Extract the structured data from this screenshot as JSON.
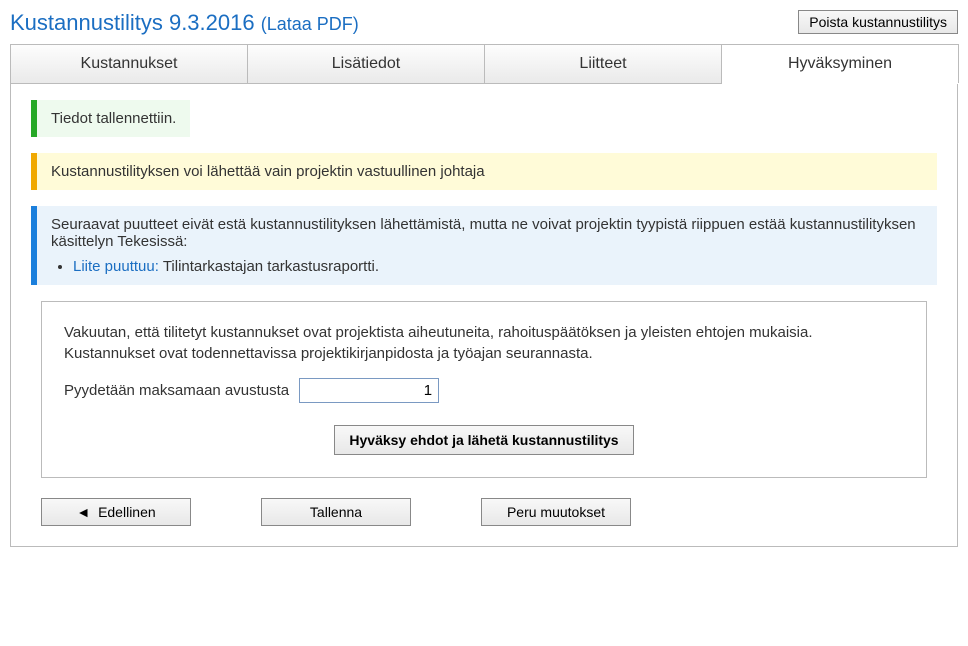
{
  "header": {
    "title": "Kustannustilitys 9.3.2016",
    "download_link": "(Lataa PDF)",
    "delete_button": "Poista kustannustilitys"
  },
  "tabs": {
    "costs": "Kustannukset",
    "details": "Lisätiedot",
    "attachments": "Liitteet",
    "approval": "Hyväksyminen"
  },
  "alerts": {
    "saved": "Tiedot tallennettiin.",
    "only_leader": "Kustannustilityksen voi lähettää vain projektin vastuullinen johtaja",
    "missing_intro": "Seuraavat puutteet eivät estä kustannustilityksen lähettämistä, mutta ne voivat projektin tyypistä riippuen estää kustannustilityksen käsittelyn Tekesissä:",
    "missing_label": "Liite puuttuu:",
    "missing_item": "Tilintarkastajan tarkastusraportti."
  },
  "confirm": {
    "statement": "Vakuutan, että tilitetyt kustannukset ovat projektista aiheutuneita, rahoituspäätöksen ja yleisten ehtojen mukaisia. Kustannukset ovat todennettavissa projektikirjanpidosta ja työajan seurannasta.",
    "pay_label": "Pyydetään maksamaan avustusta",
    "pay_value": "1",
    "approve_button": "Hyväksy ehdot ja lähetä kustannustilitys"
  },
  "footer": {
    "prev_icon": "◄",
    "previous": "Edellinen",
    "save": "Tallenna",
    "cancel": "Peru muutokset"
  }
}
